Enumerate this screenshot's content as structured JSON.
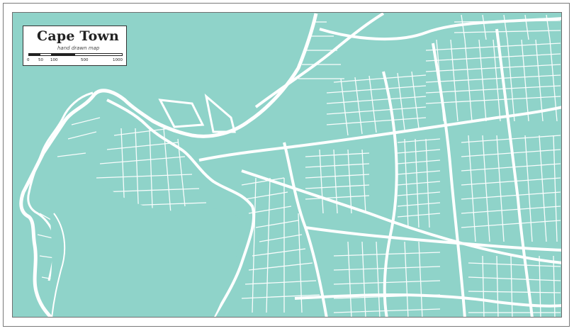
{
  "map": {
    "title": "Cape Town",
    "subtitle": "hand drawn map",
    "scale_labels": [
      "0",
      "50",
      "100",
      "500",
      "1000"
    ],
    "colors": {
      "water": "#8fd3c9",
      "land": "#8fd3c9",
      "roads": "#ffffff",
      "frame": "#6f6f6f"
    }
  }
}
